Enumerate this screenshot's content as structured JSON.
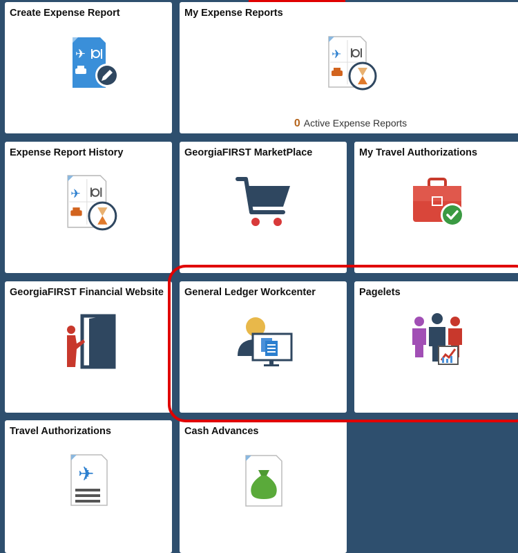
{
  "tiles": {
    "create_expense_report": {
      "title": "Create Expense Report"
    },
    "my_expense_reports": {
      "title": "My Expense Reports",
      "count": "0",
      "count_label": "Active Expense Reports"
    },
    "expense_report_history": {
      "title": "Expense Report History"
    },
    "marketplace": {
      "title": "GeorgiaFIRST MarketPlace"
    },
    "my_travel_authorizations": {
      "title": "My Travel Authorizations"
    },
    "financial_website": {
      "title": "GeorgiaFIRST Financial Website"
    },
    "gl_workcenter": {
      "title": "General Ledger Workcenter"
    },
    "pagelets": {
      "title": "Pagelets"
    },
    "travel_authorizations": {
      "title": "Travel Authorizations"
    },
    "cash_advances": {
      "title": "Cash Advances"
    }
  },
  "colors": {
    "background": "#2e4f6e",
    "tile": "#ffffff",
    "highlight": "#e00000",
    "count_accent": "#b5651d"
  },
  "icons": {
    "create_expense_report": "expense-document-edit-icon",
    "my_expense_reports": "expense-document-hourglass-icon",
    "expense_report_history": "expense-document-hourglass-icon",
    "marketplace": "shopping-cart-icon",
    "my_travel_authorizations": "briefcase-check-icon",
    "financial_website": "person-door-icon",
    "gl_workcenter": "user-monitor-icon",
    "pagelets": "people-chart-icon",
    "travel_authorizations": "travel-document-icon",
    "cash_advances": "money-bag-document-icon"
  }
}
